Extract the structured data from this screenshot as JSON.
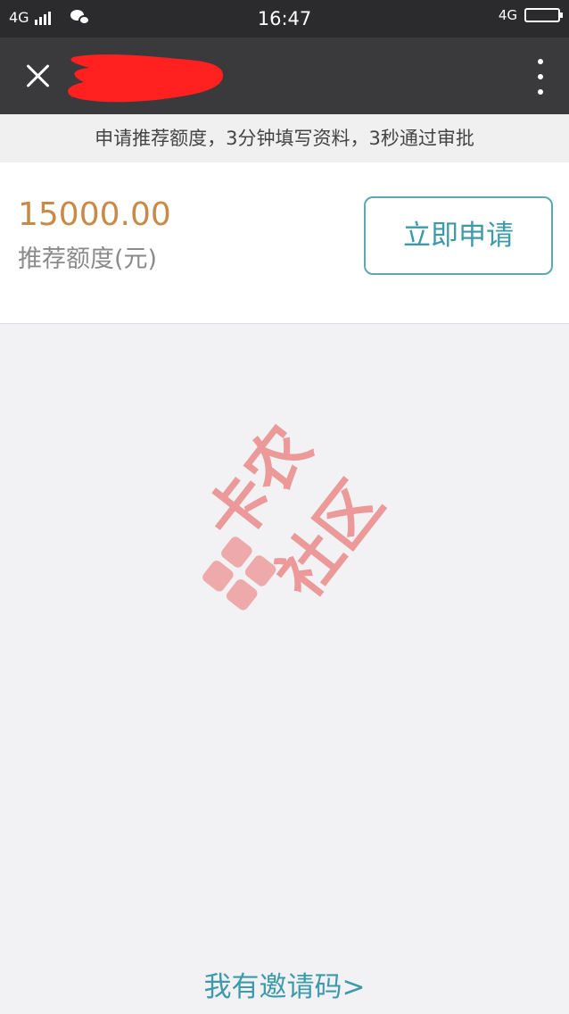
{
  "status_bar": {
    "network_left": "4G",
    "time": "16:47",
    "network_right": "4G"
  },
  "nav": {
    "close_icon": "close-icon",
    "more_icon": "more-vertical-icon",
    "title_redacted": true
  },
  "notice": {
    "text": "申请推荐额度，3分钟填写资料，3秒通过审批"
  },
  "offer": {
    "amount": "15000.00",
    "amount_label": "推荐额度(元)",
    "apply_button": "立即申请",
    "colors": {
      "amount": "#c98a48",
      "accent": "#3c9aaa"
    }
  },
  "watermark": {
    "text": "卡农社区"
  },
  "footer": {
    "invite_link": "我有邀请码>"
  }
}
